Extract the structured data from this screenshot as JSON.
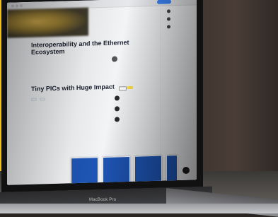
{
  "laptop": {
    "brand_label": "MacBook Pro"
  },
  "app": {
    "window_title": "",
    "top_button": ""
  },
  "article_1": {
    "title": "Interoperability and the Ethernet Ecosystem",
    "excerpt": "",
    "date": ""
  },
  "article_2": {
    "title": "Tiny PICs with Huge Impact",
    "tags": [
      "",
      ""
    ]
  },
  "sidebar": {
    "items": [
      "",
      "",
      "",
      "",
      "",
      "",
      ""
    ]
  },
  "related": {
    "label": ""
  },
  "footer": {
    "label": ""
  },
  "colors": {
    "accent_yellow": "#f2c21a",
    "card_blue": "#1e55b5",
    "background": "#2a2522"
  }
}
